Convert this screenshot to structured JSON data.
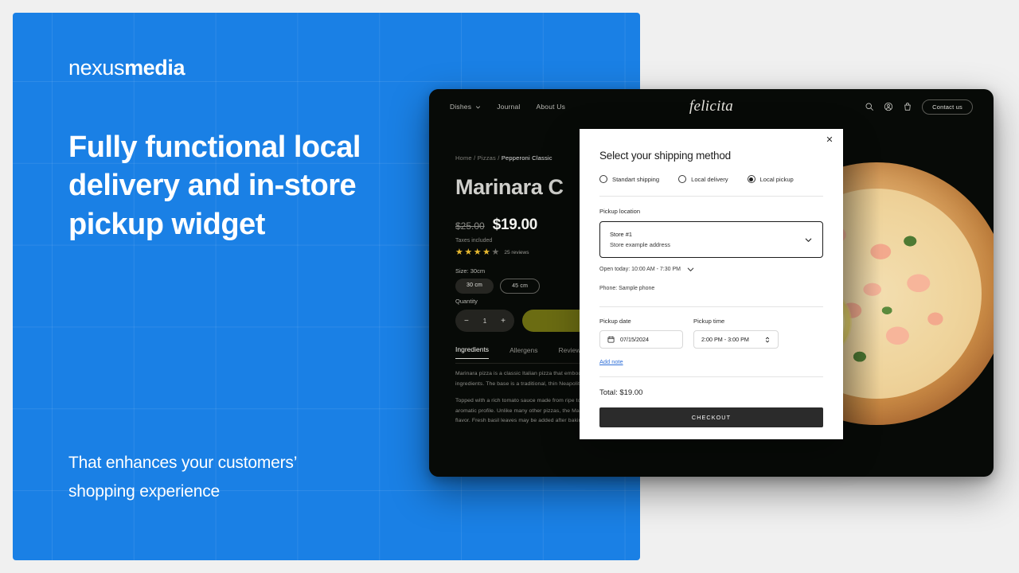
{
  "promo": {
    "brand_light": "nexus",
    "brand_bold": "media",
    "headline": "Fully functional local delivery and in-store pickup widget",
    "subhead": "That enhances your customers’ shopping experience",
    "bg_color": "#1a80e5"
  },
  "site": {
    "nav": {
      "links": [
        {
          "label": "Dishes",
          "caret": true
        },
        {
          "label": "Journal",
          "caret": false
        },
        {
          "label": "About Us",
          "caret": false
        }
      ],
      "logo": "felicita",
      "icons": [
        "search-icon",
        "account-icon",
        "bag-icon"
      ],
      "contact_label": "Contact us"
    },
    "breadcrumb": {
      "first": "Home",
      "second": "Pizzas",
      "current": "Pepperoni Classic",
      "full": "Home / Pizzas / Pepperoni Classic"
    },
    "product": {
      "title": "Marinara C",
      "price_old": "$25.00",
      "price_new": "$19.00",
      "taxes_note": "Taxes included",
      "stars_filled": 4,
      "stars_total": 5,
      "reviews": "25 reviews",
      "size_label": "Size: 30cm",
      "size_options": [
        {
          "label": "30 cm",
          "selected": true
        },
        {
          "label": "45 cm",
          "selected": false
        }
      ],
      "quantity_label": "Quantity",
      "quantity_value": "1",
      "minus": "−",
      "plus": "+",
      "cart_button_color": "#6b6c12"
    },
    "tabs": [
      {
        "label": "Ingredients",
        "active": true
      },
      {
        "label": "Allergens",
        "active": false
      },
      {
        "label": "Reviews",
        "active": false
      }
    ],
    "description": [
      "Marinara pizza is a classic Italian pizza that embodies simplicity. Originating from Naples, this pizza is celebrated for its minimal ingredients. The base is a traditional, thin Neapolitan dough, soft and slightly charred from the high-heat wood-fired oven.",
      "Topped with a rich tomato sauce made from ripe tomatoes, the sauce is seasoned with garlic, oregano, and a hint of olive oil for an aromatic profile. Unlike many other pizzas, the Marinara contains no cheese, making it a vegan-friendly option that showcases pure flavor. Fresh basil leaves may be added after baking for a burst of color and freshness."
    ]
  },
  "modal": {
    "title": "Select your shipping method",
    "close_label": "✕",
    "shipping_options": [
      {
        "label": "Standart shipping",
        "selected": false
      },
      {
        "label": "Local delivery",
        "selected": false
      },
      {
        "label": "Local pickup",
        "selected": true
      }
    ],
    "pickup_location_label": "Pickup location",
    "store_name": "Store #1",
    "store_address": "Store example address",
    "open_today": "Open today: 10:00 AM - 7:30 PM",
    "phone": "Phone: Sample phone",
    "pickup_date_label": "Pickup date",
    "pickup_date_value": "07/15/2024",
    "pickup_time_label": "Pickup time",
    "pickup_time_value": "2:00 PM - 3:00 PM",
    "add_note": "Add note",
    "total": "Total: $19.00",
    "checkout": "CHECKOUT",
    "link_color": "#2f6fd8",
    "button_color": "#2b2b2b"
  }
}
